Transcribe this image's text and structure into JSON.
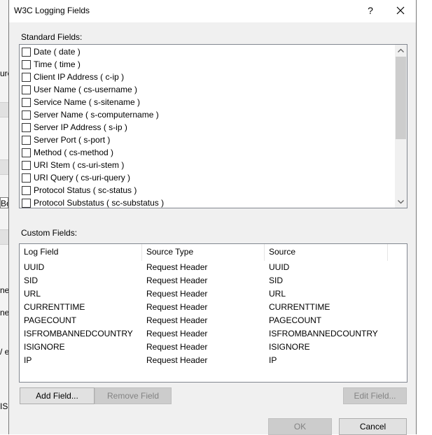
{
  "dialog": {
    "title": "W3C Logging Fields",
    "help_label": "?",
    "close_icon": "close-icon"
  },
  "background": {
    "fragments": [
      "ure",
      "Bo",
      "ne",
      "ne",
      "/ e",
      "IS"
    ]
  },
  "standard_fields": {
    "label": "Standard Fields:",
    "items": [
      {
        "label": "Date ( date )",
        "checked": false
      },
      {
        "label": "Time ( time )",
        "checked": false
      },
      {
        "label": "Client IP Address ( c-ip )",
        "checked": false
      },
      {
        "label": "User Name ( cs-username )",
        "checked": false
      },
      {
        "label": "Service Name ( s-sitename )",
        "checked": false
      },
      {
        "label": "Server Name ( s-computername )",
        "checked": false
      },
      {
        "label": "Server IP Address ( s-ip )",
        "checked": false
      },
      {
        "label": "Server Port ( s-port )",
        "checked": false
      },
      {
        "label": "Method ( cs-method )",
        "checked": false
      },
      {
        "label": "URI Stem ( cs-uri-stem )",
        "checked": false
      },
      {
        "label": "URI Query ( cs-uri-query )",
        "checked": false
      },
      {
        "label": "Protocol Status ( sc-status )",
        "checked": false
      },
      {
        "label": "Protocol Substatus ( sc-substatus )",
        "checked": false
      }
    ]
  },
  "custom_fields": {
    "label": "Custom Fields:",
    "columns": [
      "Log Field",
      "Source Type",
      "Source"
    ],
    "rows": [
      [
        "UUID",
        "Request Header",
        "UUID"
      ],
      [
        "SID",
        "Request Header",
        "SID"
      ],
      [
        "URL",
        "Request Header",
        "URL"
      ],
      [
        "CURRENTTIME",
        "Request Header",
        "CURRENTTIME"
      ],
      [
        "PAGECOUNT",
        "Request Header",
        "PAGECOUNT"
      ],
      [
        "ISFROMBANNEDCOUNTRY",
        "Request Header",
        "ISFROMBANNEDCOUNTRY"
      ],
      [
        "ISIGNORE",
        "Request Header",
        "ISIGNORE"
      ],
      [
        "IP",
        "Request Header",
        "IP"
      ]
    ]
  },
  "buttons": {
    "add_field": "Add Field...",
    "remove_field": "Remove Field",
    "edit_field": "Edit Field...",
    "ok": "OK",
    "cancel": "Cancel"
  }
}
